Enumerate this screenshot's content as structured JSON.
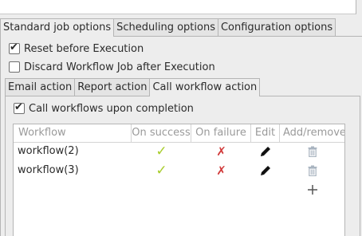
{
  "outer_tabs": [
    "Standard job options",
    "Scheduling options",
    "Configuration options"
  ],
  "options": {
    "reset_before_execution": {
      "label": "Reset before Execution",
      "checked": true
    },
    "discard_after_execution": {
      "label": "Discard Workflow Job after Execution",
      "checked": false
    }
  },
  "inner_tabs": [
    "Email action",
    "Report action",
    "Call workflow action"
  ],
  "call_workflows": {
    "label": "Call workflows upon completion",
    "checked": true
  },
  "table": {
    "columns": [
      "Workflow",
      "On success",
      "On failure",
      "Edit",
      "Add/remove"
    ],
    "rows": [
      {
        "workflow": "workflow(2)",
        "on_success": "✓",
        "on_failure": "✗"
      },
      {
        "workflow": "workflow(3)",
        "on_success": "✓",
        "on_failure": "✗"
      }
    ]
  },
  "colors": {
    "success": "#a7cc2a",
    "failure": "#d13b3b"
  }
}
